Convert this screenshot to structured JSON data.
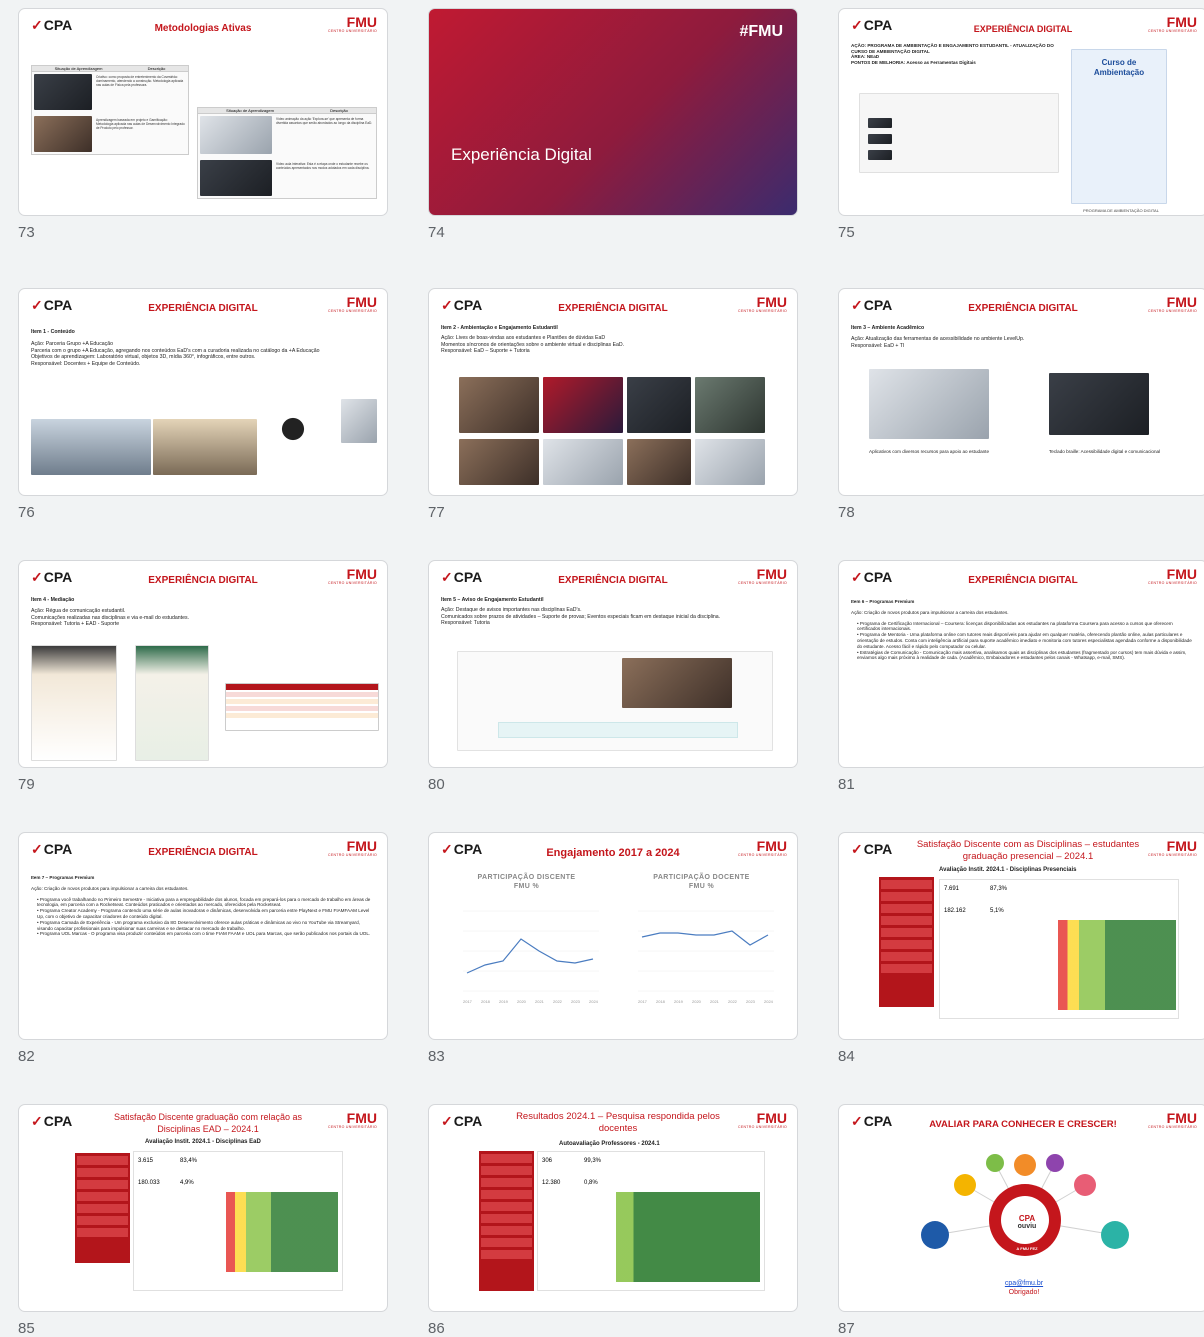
{
  "slides": [
    {
      "num": "73",
      "title": "Metodologias Ativas",
      "t1": "Situação de Aprendizagem",
      "t2": "Descrição",
      "d1": "Criativo: como proposta de entretenimento da Covestrida: dominamento, atendendo a construção. Metodologia aplicada nas aulas de Física pela professora.",
      "d2": "Aprendizagem baseada em projeto e Gamificação: Metodologia aplicada nas aulas de Desenvolvimento Integrado de Produto pelo professor.",
      "d3": "Vídeo animação da ação 'Explora-se' que apresenta de forma divertida assuntos que serão abordados ao longo da disciplina EaD.",
      "d4": "Vídeo aula interativa: Esta é a etapa onde o estudante recebe os conteúdos apresentados nos modos adotados em cada disciplina."
    },
    {
      "num": "74",
      "hash": "#FMU",
      "cover": "Experiência Digital"
    },
    {
      "num": "75",
      "title": "EXPERIÊNCIA DIGITAL",
      "acao": "AÇÃO:  PROGRAMA DE AMBIENTAÇÃO E ENGAJAMENTO ESTUDANTIL - ATUALIZAÇÃO DO CURSO DE AMBIENTAÇÃO DIGITAL",
      "area": "ÁREA: NEaD",
      "pontos": "PONTOS DE MELHORIA: Acesso as Ferramentas Digitais",
      "curso1": "Curso de",
      "curso2": "Ambientação",
      "caption": "PROGRAMA DE AMBIENTAÇÃO DIGITAL"
    },
    {
      "num": "76",
      "title": "EXPERIÊNCIA DIGITAL",
      "item": "Item 1 - Conteúdo",
      "l1": "Ação: Parceria Grupo +A Educação",
      "l2": "Parceria com o grupo +A Educação, agregando nos conteúdos EaD's com a curadoria realizada no catálogo da +A Educação",
      "l3": "Objetivos de aprendizagem: Laboratório virtual, objetos 3D, mídia 360°, infográficos, entre outros.",
      "l4": "Responsável: Docentes + Equipe de Conteúdo."
    },
    {
      "num": "77",
      "title": "EXPERIÊNCIA DIGITAL",
      "item": "Item 2 - Ambientação e Engajamento Estudantil",
      "l1": "Ação: Lives de boas-vindas aos estudantes e Plantões de dúvidas EaD",
      "l2": "Momentos síncronos de orientações sobre o ambiente virtual e disciplinas EaD.",
      "l3": "Responsável: EaD – Suporte + Tutoria"
    },
    {
      "num": "78",
      "title": "EXPERIÊNCIA DIGITAL",
      "item": "Item 3 – Ambiente Acadêmico",
      "l1": "Ação: Atualização das ferramentas de acessibilidade no ambiente LevelUp.",
      "l2": "Responsável: EaD + TI",
      "cap1": "Aplicativos com diversos recursos para apoio ao estudante",
      "cap2": "Teclado braille: Acessibilidade digital e comunicacional"
    },
    {
      "num": "79",
      "title": "EXPERIÊNCIA DIGITAL",
      "item": "Item 4 - Mediação",
      "l1": "Ação: Régua de comunicação estudantil.",
      "l2": "Comunicações realizadas nas disciplinas e via e-mail do estudantes.",
      "l3": "Responsável: Tutoria + EAD - Suporte"
    },
    {
      "num": "80",
      "title": "EXPERIÊNCIA DIGITAL",
      "item": "Item 5 – Aviso de Engajamento Estudantil",
      "l1": "Ação: Destaque de avisos importantes nas disciplinas EaD's.",
      "l2": "Comunicados sobre prazos de atividades – Suporte de provas; Eventos especiais ficam em destaque inicial da disciplina.",
      "l3": "Responsável: Tutoria"
    },
    {
      "num": "81",
      "title": "EXPERIÊNCIA DIGITAL",
      "item": "Item 6 – Programas Premium",
      "l1": "Ação: Criação de novos produtos para impulsionar a carreira dos estudantes.",
      "b1": "Programa de Certificação Internacional – Coursera: licenças disponibilizadas aos estudantes na plataforma Coursera para acesso a cursos que oferecem certificados internacionais.",
      "b2": "Programa de Mentoria - Uma plataforma online com tutores reais disponíveis para ajudar em qualquer matéria, oferecendo plantão online, aulas particulares e orientação de estudos. Conta com inteligência artificial para suporte acadêmico imediato e monitoria com tutores especialistas agendada conforme a disponibilidade do estudante. Acesso fácil e rápido pelo computador ou celular.",
      "b3": "Estratégias de Comunicação - Comunicação mais assertiva, analisamos quais as disciplinas dos estudantes (fragmentado por cursos) tem mais dúvida e assim, enviamos algo mais próximo à realidade de cada. (Acadêmico, Embaixadores e estudantes pelos canais - Whatsapp, e-mail, SMS)."
    },
    {
      "num": "82",
      "title": "EXPERIÊNCIA DIGITAL",
      "item": "Item 7 – Programas Premium",
      "l1": "Ação: Criação de novos produtos para impulsionar a carreira dos estudantes.",
      "b1": "Programa você trabalhando no Primeiro Semestre - Iniciativa para a empregabilidade dos alunos, focada em prepará-los para o mercado de trabalho em áreas de tecnologia, em parceria com a Rocketseat. Conteúdos praticados e orientados ao mercado, oferecidos pela Rocketseat.",
      "b2": "Programa Creator Academy - Programa contendo uma série de aulas inovadoras e dinâmicas, desenvolvida em parceria entre PlayNext e FMU FIAMFAAM Level Up, com o objetivo de capacitar criadores de conteúdo digital.",
      "b3": "Programa Camada de Experiência - Um programa exclusivo da 8G Desenvolvimento oferece aulas práticas e dinâmicas ao vivo no YouTube via Streamyard, visando capacitar profissionais para impulsionar suas carreiras e se destacar no mercado de trabalho.",
      "b4": "Programa UOL Marcas - O programa visa produzir conteúdos em parceria com o time FIAM FAAM e UOL para Marcas, que serão publicados nos portais da UOL."
    },
    {
      "num": "83",
      "title": "Engajamento 2017 a 2024",
      "g1": "PARTICIPAÇÃO DISCENTE",
      "g1s": "FMU %",
      "g2": "PARTICIPAÇÃO DOCENTE",
      "g2s": "FMU %",
      "years": [
        "2017",
        "2018",
        "2019",
        "2020",
        "2021",
        "2022",
        "2023",
        "2024"
      ]
    },
    {
      "num": "84",
      "title": "Satisfação Discente com as Disciplinas – estudantes graduação presencial – 2024.1",
      "sub": "Avaliação Instit. 2024.1 - Disciplinas Presenciais",
      "v1": "7.691",
      "v2": "87,3%",
      "v3": "182.162",
      "v4": "5,1%"
    },
    {
      "num": "85",
      "title": "Satisfação Discente graduação com relação as Disciplinas EAD – 2024.1",
      "sub": "Avaliação Instit. 2024.1 - Disciplinas EaD",
      "v1": "3.615",
      "v2": "83,4%",
      "v3": "180.033",
      "v4": "4,9%"
    },
    {
      "num": "86",
      "title": "Resultados 2024.1 – Pesquisa respondida pelos docentes",
      "sub": "Autoavaliação Professores - 2024.1",
      "v1": "306",
      "v2": "99,3%",
      "v3": "12.380",
      "v4": "0,8%"
    },
    {
      "num": "87",
      "title": "AVALIAR PARA CONHECER E CRESCER!",
      "c1": "VOCÊ PEDIU",
      "c2": "CPA",
      "c3": "ouviu",
      "c4": "A FMU FEZ",
      "mail": "cpa@fmu.br",
      "thanks": "Obrigado!"
    }
  ],
  "brand": {
    "cpa": "CPA",
    "fmu": "FMU",
    "fmu_sub": "CENTRO UNIVERSITÁRIO",
    "red": "#c4161c"
  }
}
